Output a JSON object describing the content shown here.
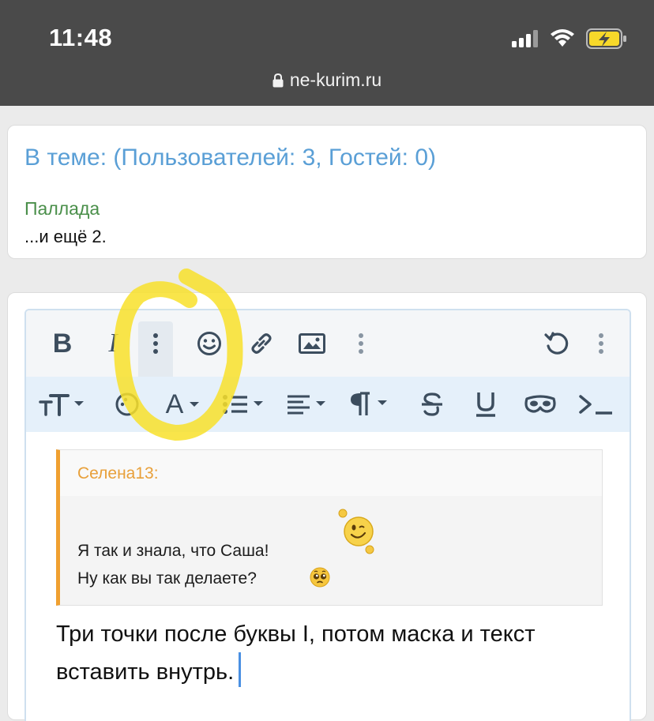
{
  "status_bar": {
    "time": "11:48",
    "url": "ne-kurim.ru",
    "icons": [
      "signal-icon",
      "wifi-icon",
      "battery-charging-icon"
    ]
  },
  "online_card": {
    "title": "В теме: (Пользователей: 3, Гостей: 0)",
    "member": "Паллада",
    "more": "...и ещё 2."
  },
  "editor": {
    "toolbar_row1": [
      "bold",
      "italic",
      "more-vertical",
      "smilie",
      "link",
      "image",
      "more-vertical",
      "undo",
      "more-vertical"
    ],
    "toolbar_row2": [
      "font-size",
      "color-palette",
      "font-color",
      "list",
      "align",
      "paragraph",
      "strikethrough",
      "underline",
      "spoiler-mask",
      "code"
    ],
    "bold_label": "B",
    "italic_label": "I",
    "font_color_label": "A",
    "quote": {
      "author": "Селена13:",
      "line1": "Я так и знала, что Саша!",
      "line2": "Ну как вы так делаете?"
    },
    "reply_text": "Три точки после буквы I, потом маска и текст вставить внутрь."
  },
  "colors": {
    "status_bar_bg": "#4a4a4a",
    "link_blue": "#5a9fd6",
    "member_green": "#4a8f4a",
    "quote_accent": "#f0a030",
    "toolbar_icon": "#3c4d5e",
    "highlight_circle": "#f8e02a",
    "caret": "#4a90e2"
  }
}
